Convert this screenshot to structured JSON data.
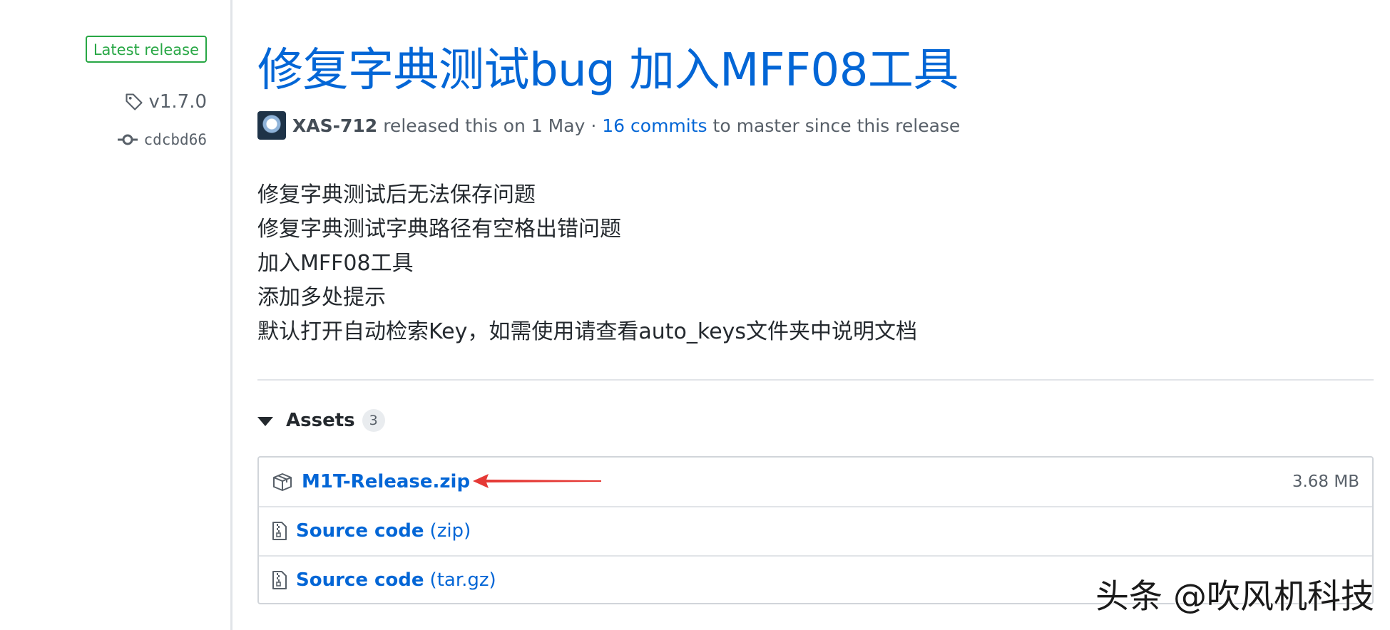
{
  "sidebar": {
    "latest_badge": "Latest release",
    "tag": "v1.7.0",
    "commit": "cdcbd66"
  },
  "release": {
    "title": "修复字典测试bug 加入MFF08工具",
    "author": "XAS-712",
    "released_text": "released this on 1 May ·",
    "commits_link": "16 commits",
    "branch_text": "to master since this release",
    "notes": [
      "修复字典测试后无法保存问题",
      "修复字典测试字典路径有空格出错问题",
      "加入MFF08工具",
      "添加多处提示",
      "默认打开自动检索Key，如需使用请查看auto_keys文件夹中说明文档"
    ]
  },
  "assets": {
    "label": "Assets",
    "count": "3",
    "items": [
      {
        "name": "M1T-Release.zip",
        "ext": "",
        "size": "3.68 MB",
        "icon": "package-icon"
      },
      {
        "name": "Source code",
        "ext": "(zip)",
        "size": "",
        "icon": "file-zip-icon"
      },
      {
        "name": "Source code",
        "ext": "(tar.gz)",
        "size": "",
        "icon": "file-zip-icon"
      }
    ]
  },
  "watermark": "头条 @吹风机科技",
  "colors": {
    "link": "#0366d6",
    "latest_green": "#28a745",
    "arrow_red": "#e53935"
  }
}
